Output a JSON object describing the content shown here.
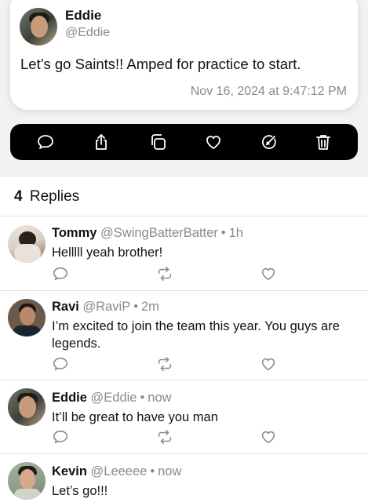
{
  "post": {
    "name": "Eddie",
    "handle": "@Eddie",
    "text": "Let’s go Saints!! Amped for practice to start.",
    "timestamp": "Nov 16, 2024 at 9:47:12 PM"
  },
  "actions": [
    "comment-icon",
    "share-icon",
    "copy-icon",
    "heart-icon",
    "edit-icon",
    "trash-icon"
  ],
  "replies_header": {
    "count": "4",
    "label": "Replies"
  },
  "replies": [
    {
      "name": "Tommy",
      "handle": "@SwingBatterBatter",
      "age": "1h",
      "text": "Helllll yeah brother!"
    },
    {
      "name": "Ravi",
      "handle": "@RaviP",
      "age": "2m",
      "text": "I’m excited to join the team this year. You guys are legends."
    },
    {
      "name": "Eddie",
      "handle": "@Eddie",
      "age": "now",
      "text": "It’ll be great to have you man"
    },
    {
      "name": "Kevin",
      "handle": "@Leeeee",
      "age": "now",
      "text": "Let’s go!!!"
    }
  ],
  "separator": "•",
  "colors": {
    "muted": "#8a8a8e",
    "bar": "#000000",
    "card": "#ffffff"
  }
}
